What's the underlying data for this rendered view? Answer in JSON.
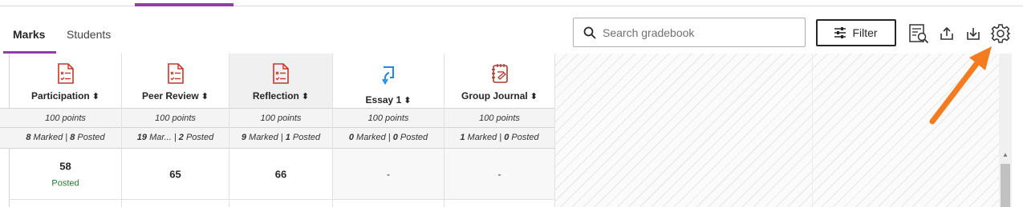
{
  "tabs": [
    {
      "label": "Marks",
      "active": true
    },
    {
      "label": "Students",
      "active": false
    }
  ],
  "search": {
    "placeholder": "Search gradebook",
    "value": ""
  },
  "filter": {
    "label": "Filter"
  },
  "toolbar_icons": [
    "report-icon",
    "upload-icon",
    "download-icon",
    "gear-icon"
  ],
  "columns": [
    {
      "title": "Participation",
      "icon": "assignment-icon",
      "points": "100 points",
      "marked": "8",
      "marked_label": "Marked",
      "posted": "8",
      "posted_label": "Posted",
      "cell_value": "58",
      "cell_status": "Posted"
    },
    {
      "title": "Peer Review",
      "icon": "assignment-icon",
      "points": "100 points",
      "marked": "19",
      "marked_label": "Mar...",
      "posted": "2",
      "posted_label": "Posted",
      "cell_value": "65",
      "cell_status": ""
    },
    {
      "title": "Reflection",
      "icon": "assignment-icon",
      "points": "100 points",
      "marked": "9",
      "marked_label": "Marked",
      "posted": "1",
      "posted_label": "Posted",
      "cell_value": "66",
      "cell_status": ""
    },
    {
      "title": "Essay 1",
      "icon": "turnitin-icon",
      "points": "100 points",
      "marked": "0",
      "marked_label": "Marked",
      "posted": "0",
      "posted_label": "Posted",
      "cell_value": "-",
      "cell_status": ""
    },
    {
      "title": "Group Journal",
      "icon": "journal-icon",
      "points": "100 points",
      "marked": "1",
      "marked_label": "Marked",
      "posted": "0",
      "posted_label": "Posted",
      "cell_value": "-",
      "cell_status": ""
    }
  ],
  "separator": "|",
  "colors": {
    "accent": "#8f3ea8",
    "icon_red": "#c0392b",
    "icon_blue": "#1e88e5",
    "posted_green": "#2b7a2b",
    "arrow_orange": "#f47c20"
  }
}
